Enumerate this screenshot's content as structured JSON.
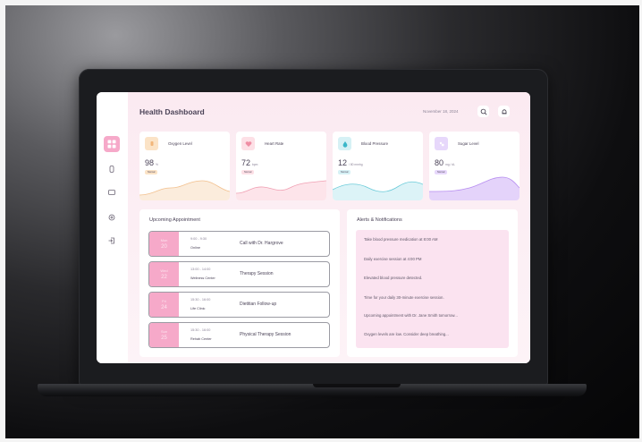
{
  "header": {
    "title": "Health Dashboard",
    "date": "November 18, 2024"
  },
  "sidebar": {
    "items": [
      {
        "icon": "dashboard-icon",
        "active": true
      },
      {
        "icon": "watch-icon",
        "active": false
      },
      {
        "icon": "message-icon",
        "active": false
      },
      {
        "icon": "settings-icon",
        "active": false
      },
      {
        "icon": "logout-icon",
        "active": false
      }
    ]
  },
  "stats": [
    {
      "title": "Oxygen Level",
      "value": "98",
      "unit": "%",
      "status": "Normal",
      "color": "#f4c89a",
      "icon": "oxygen-icon"
    },
    {
      "title": "Heart Rate",
      "value": "72",
      "unit": "bpm",
      "status": "Normal",
      "color": "#f3a4b8",
      "icon": "heart-icon"
    },
    {
      "title": "Blood Pressure",
      "value": "12",
      "unit": "/ 80 mmhg",
      "status": "Normal",
      "color": "#7fd3df",
      "icon": "drop-icon"
    },
    {
      "title": "Sugar Level",
      "value": "80",
      "unit": "mg / dL",
      "status": "Normal",
      "color": "#c8a8f0",
      "icon": "sugar-icon"
    }
  ],
  "appointments": {
    "title": "Upcoming Appointment",
    "items": [
      {
        "day": "Mon",
        "date": "20",
        "time": "9:00 - 9:30",
        "place": "Online",
        "title": "Call with Dr. Hargrove"
      },
      {
        "day": "Wed",
        "date": "22",
        "time": "13:00 - 14:00",
        "place": "Wellness Center",
        "title": "Therapy Session"
      },
      {
        "day": "Fri",
        "date": "24",
        "time": "15:30 - 16:00",
        "place": "Life Clinic",
        "title": "Dietitian Follow-up"
      },
      {
        "day": "Sun",
        "date": "25",
        "time": "15:30 - 16:00",
        "place": "Rehab Center",
        "title": "Physical Therapy Session"
      }
    ]
  },
  "alerts": {
    "title": "Alerts & Notifications",
    "items": [
      "Take blood pressure medication at 8:00 AM",
      "Daily exercise session at 4:00 PM",
      "Elevated blood pressure detected.",
      "Time for your daily 30-minute exercise session.",
      "Upcoming appointment with Dr. Jane Smith tomorrow...",
      "Oxygen levels are low. Consider deep breathing..."
    ]
  }
}
